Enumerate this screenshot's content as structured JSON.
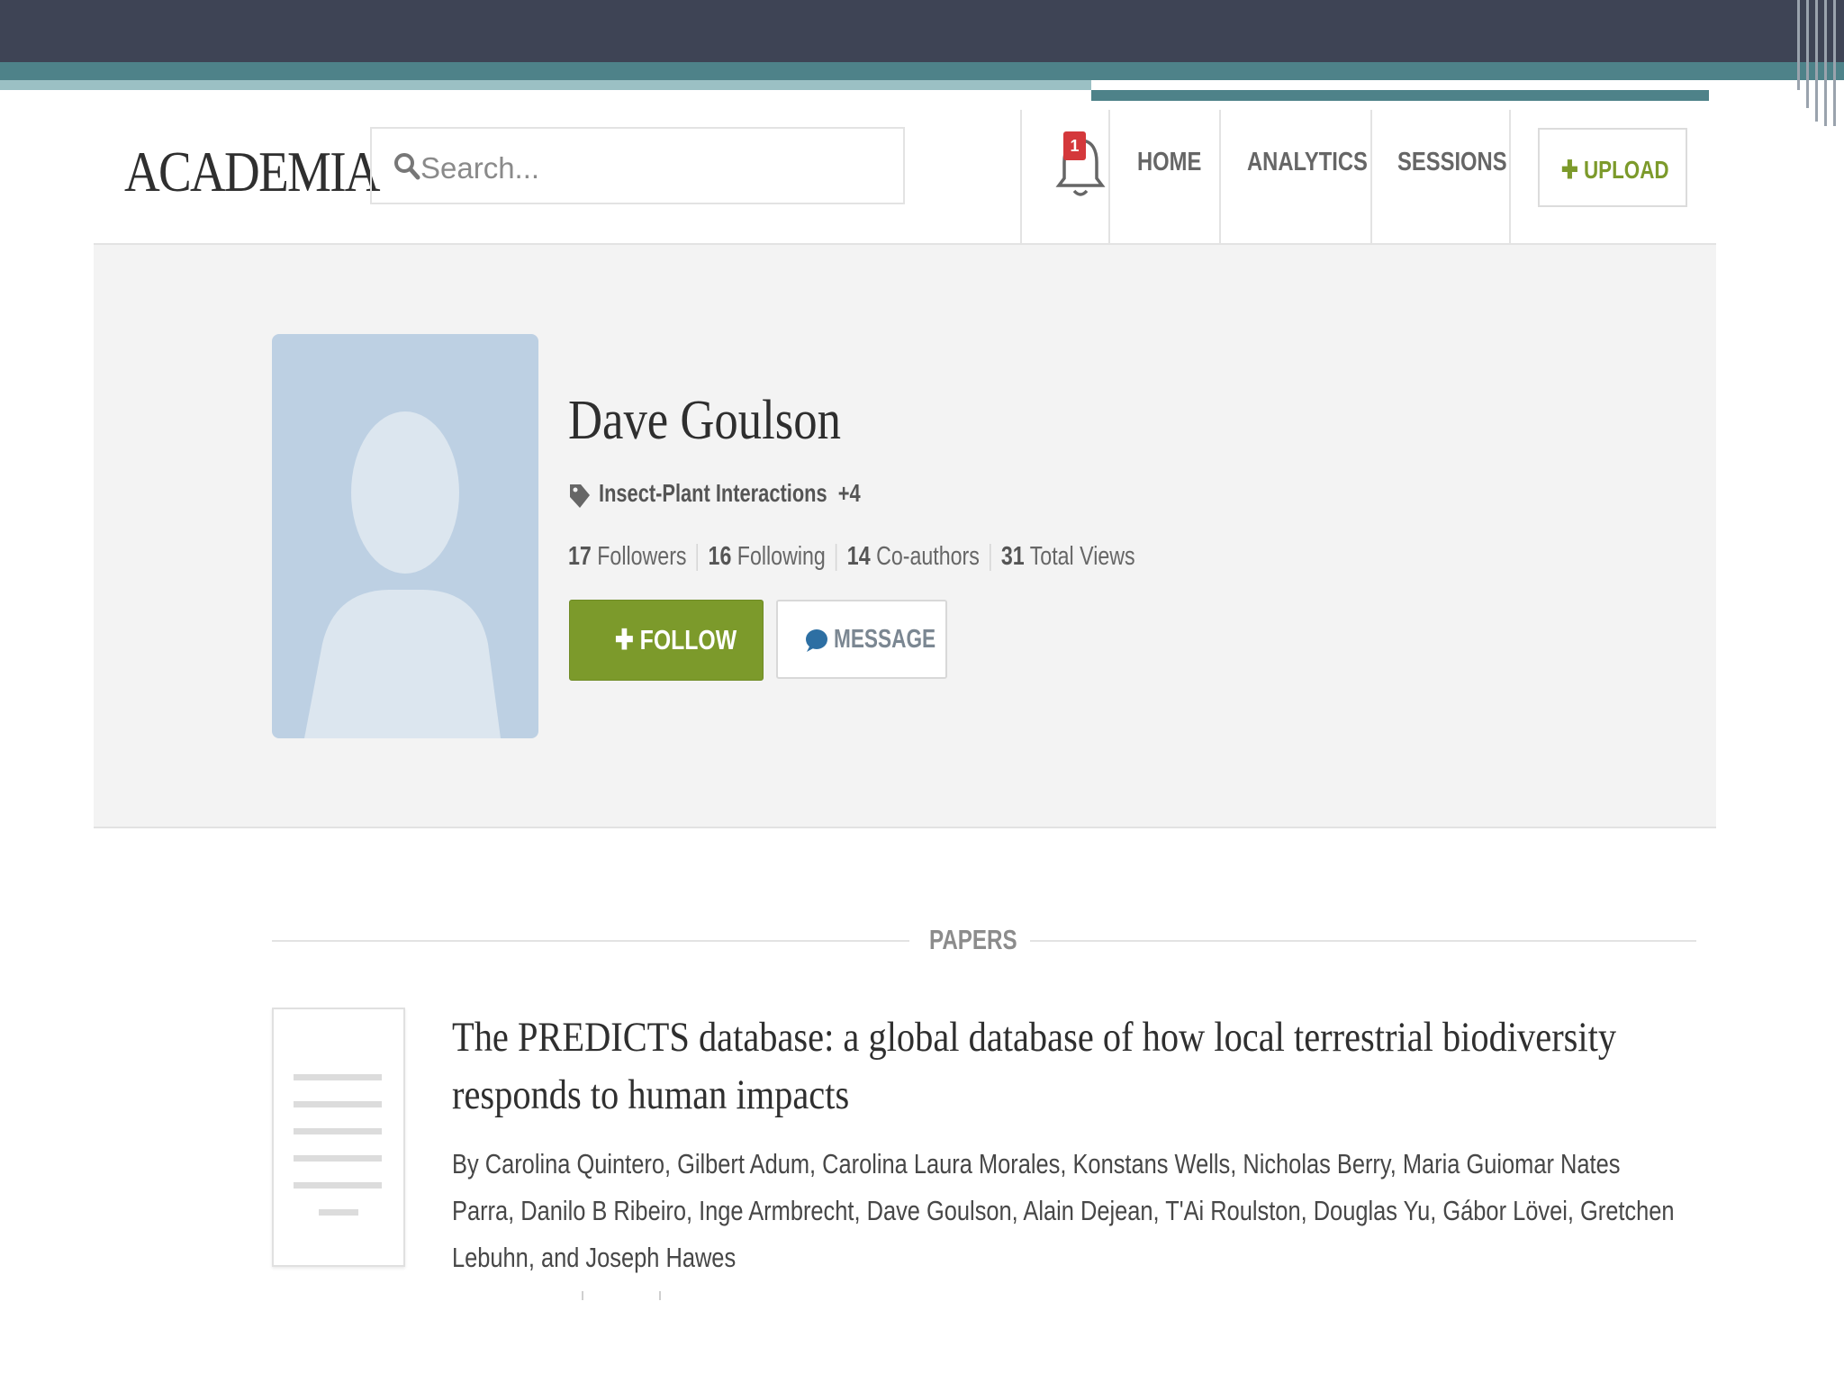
{
  "header": {
    "logo": "ACADEMIA",
    "search_placeholder": "Search...",
    "notification_count": "1",
    "nav": [
      "HOME",
      "ANALYTICS",
      "SESSIONS"
    ],
    "upload_label": "UPLOAD"
  },
  "profile": {
    "name": "Dave Goulson",
    "tags": "Insect-Plant Interactions",
    "tags_more": "+4",
    "stats": [
      {
        "count": "17",
        "label": "Followers"
      },
      {
        "count": "16",
        "label": "Following"
      },
      {
        "count": "14",
        "label": "Co-authors"
      },
      {
        "count": "31",
        "label": "Total Views"
      }
    ],
    "follow_label": "FOLLOW",
    "message_label": "MESSAGE"
  },
  "papers": {
    "heading": "PAPERS",
    "items": [
      {
        "title": "The PREDICTS database: a global database of how local terrestrial biodiversity responds to human impacts",
        "authors": "By Carolina Quintero, Gilbert Adum, Carolina Laura Morales, Konstans Wells, Nicholas Berry, Maria Guiomar Nates Parra, Danilo B Ribeiro, Inge Armbrecht, Dave Goulson, Alain Dejean, T'Ai Roulston, Douglas Yu, Gábor Lövei, Gretchen Lebuhn, and Joseph Hawes"
      }
    ]
  },
  "colors": {
    "accent_green": "#7c9a2b",
    "badge_red": "#d4383b",
    "slide_dark": "#3e4455",
    "slide_teal": "#4e8289"
  }
}
